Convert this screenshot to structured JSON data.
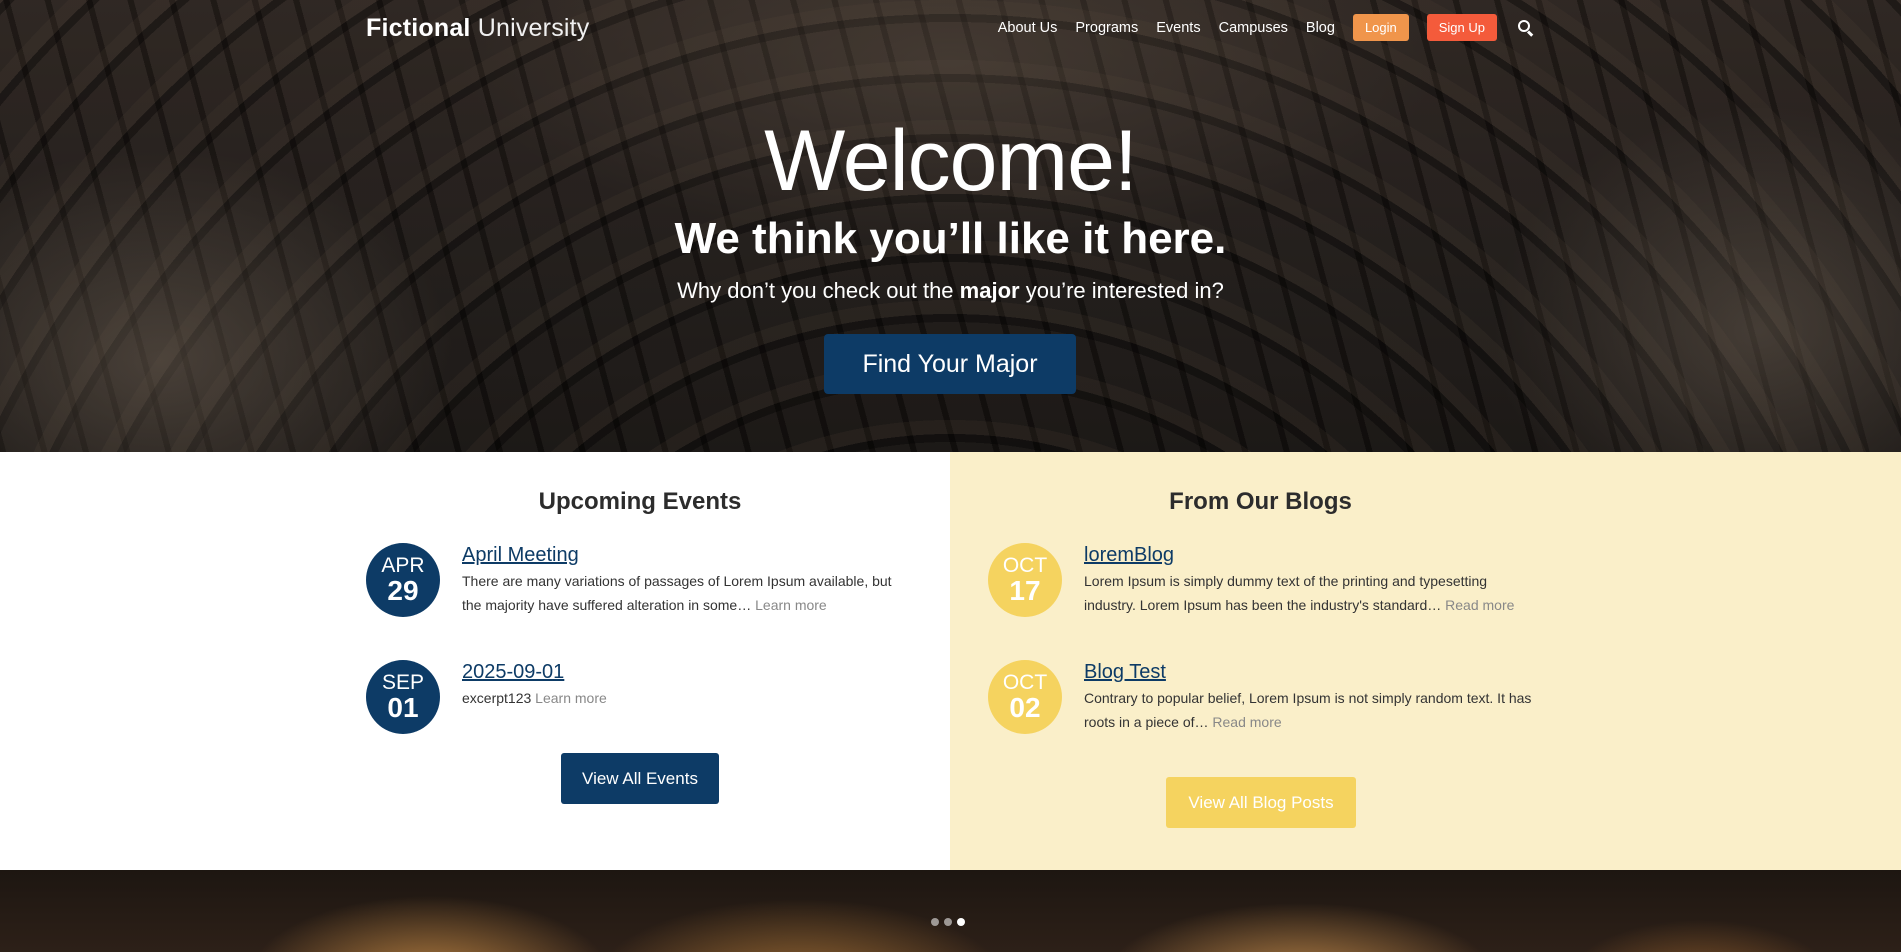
{
  "header": {
    "logo_bold": "Fictional",
    "logo_light": "University",
    "nav": [
      "About Us",
      "Programs",
      "Events",
      "Campuses",
      "Blog"
    ],
    "login_label": "Login",
    "signup_label": "Sign Up",
    "search_icon": "search-icon"
  },
  "hero": {
    "title": "Welcome!",
    "subtitle": "We think you’ll like it here.",
    "line_before": "Why don’t you check out the ",
    "line_strong": "major",
    "line_after": " you’re interested in?",
    "button_label": "Find Your Major"
  },
  "events": {
    "title": "Upcoming Events",
    "items": [
      {
        "month": "APR",
        "day": "29",
        "title": "April Meeting",
        "excerpt": "There are many variations of passages of Lorem Ipsum available, but the majority have suffered alteration in some…",
        "more": "Learn more"
      },
      {
        "month": "SEP",
        "day": "01",
        "title": "2025-09-01",
        "excerpt": "excerpt123",
        "more": "Learn more"
      }
    ],
    "button_label": "View All Events"
  },
  "blogs": {
    "title": "From Our Blogs",
    "items": [
      {
        "month": "OCT",
        "day": "17",
        "title": "loremBlog",
        "excerpt": "Lorem Ipsum is simply dummy text of the printing and typesetting industry. Lorem Ipsum has been the industry's standard…",
        "more": "Read more"
      },
      {
        "month": "OCT",
        "day": "02",
        "title": "Blog Test",
        "excerpt": "Contrary to popular belief, Lorem Ipsum is not simply random text. It has roots in a piece of…",
        "more": "Read more"
      }
    ],
    "button_label": "View All Blog Posts"
  },
  "colors": {
    "primary_blue": "#0d3b66",
    "gold": "#f5d35f",
    "blog_bg": "#faefc9",
    "login_orange": "#f0954b",
    "signup_red": "#f45b3b"
  }
}
